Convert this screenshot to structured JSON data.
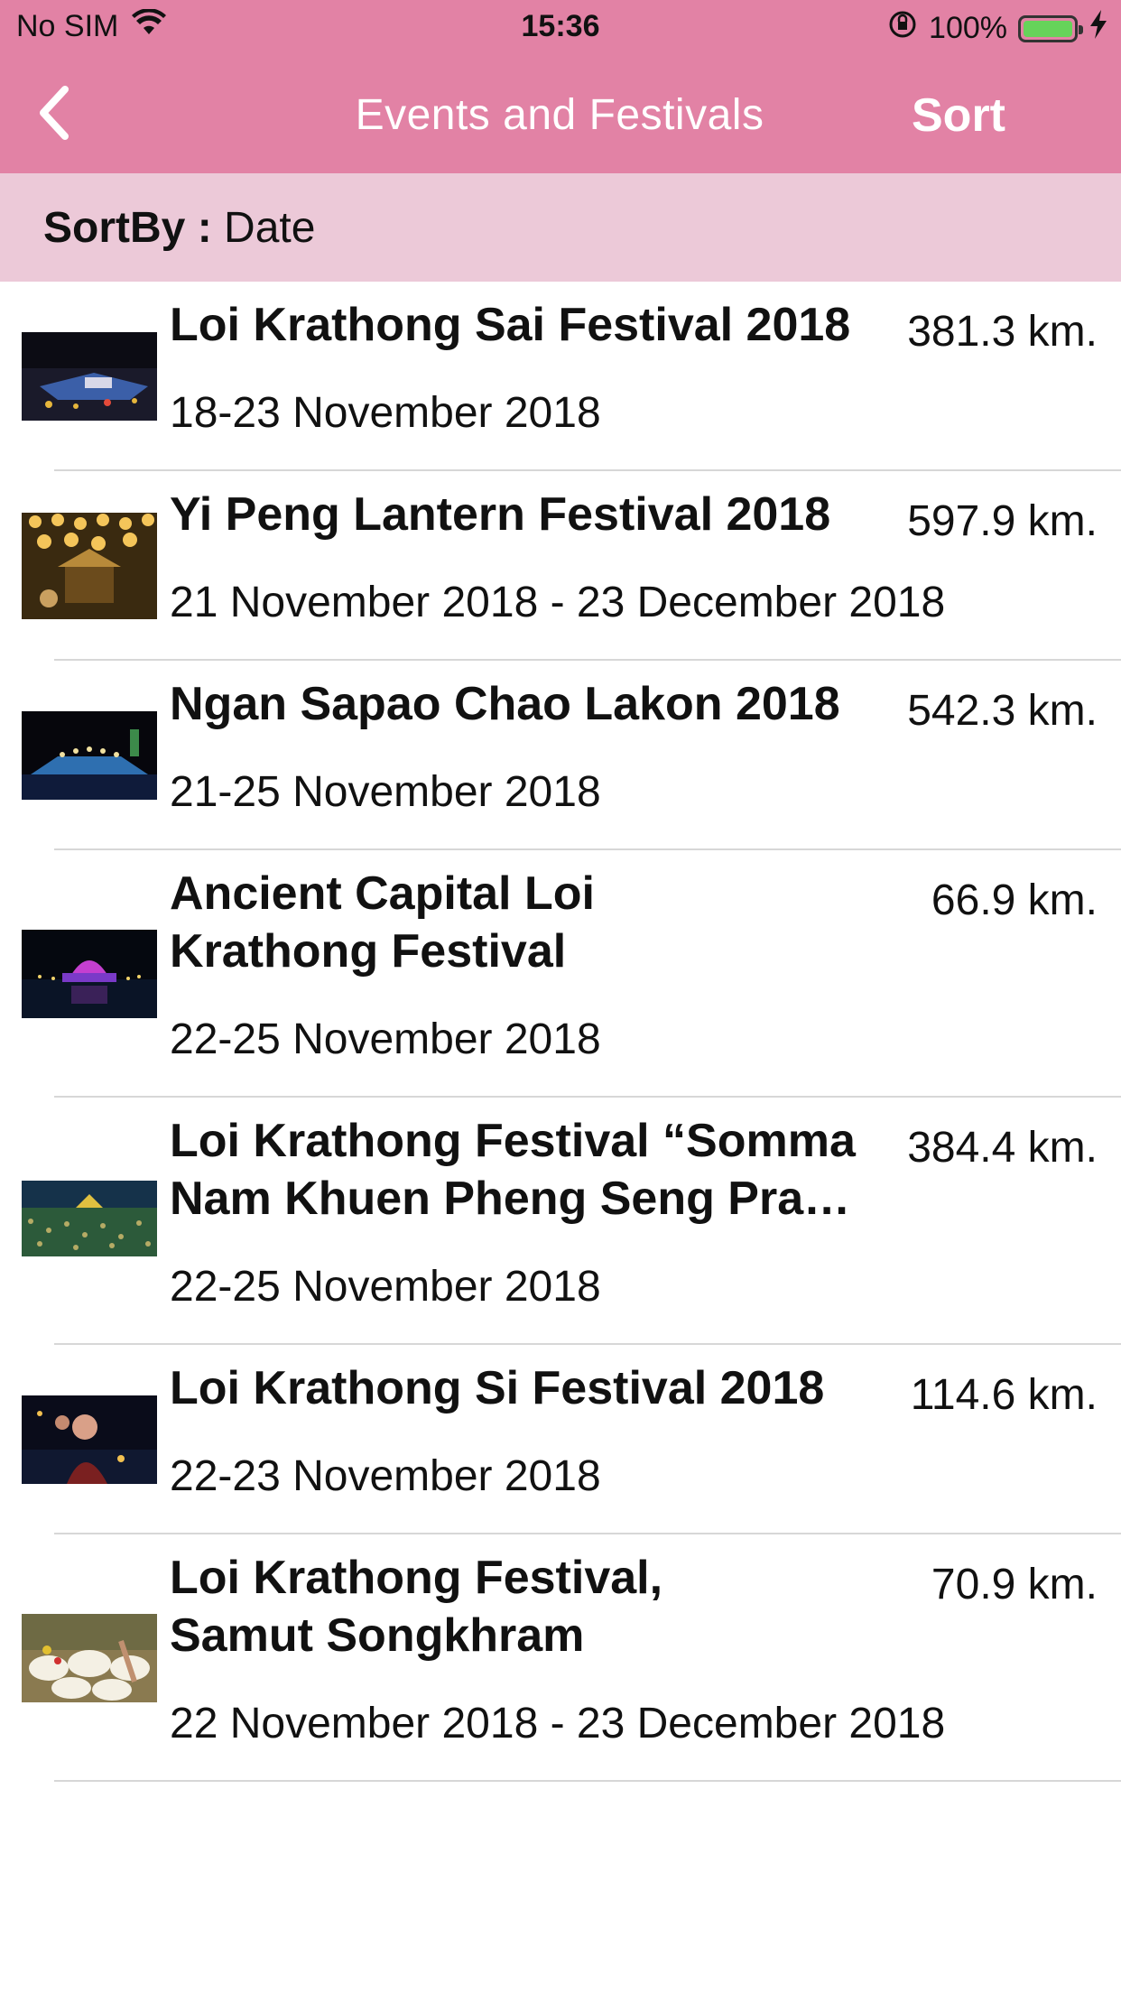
{
  "status_bar": {
    "carrier": "No SIM",
    "time": "15:36",
    "battery_percent": "100%",
    "battery_level": 1.0
  },
  "nav": {
    "title": "Events and Festivals",
    "sort_label": "Sort",
    "back_icon": "chevron-left-icon"
  },
  "sort_header": {
    "label": "SortBy :",
    "value": "Date"
  },
  "events": [
    {
      "title": "Loi Krathong Sai Festival 2018",
      "distance": "381.3 km.",
      "date": "18-23 November 2018"
    },
    {
      "title": "Yi Peng Lantern Festival 2018",
      "distance": "597.9 km.",
      "date": "21 November 2018 - 23 December 2018"
    },
    {
      "title": "Ngan Sapao Chao Lakon 2018",
      "distance": "542.3 km.",
      "date": "21-25 November 2018"
    },
    {
      "title": "Ancient Capital Loi Krathong Festival",
      "distance": "66.9 km.",
      "date": "22-25 November 2018"
    },
    {
      "title": "Loi Krathong Festival “Somma Nam Khuen Pheng Seng Pra…",
      "distance": "384.4 km.",
      "date": "22-25 November 2018"
    },
    {
      "title": "Loi Krathong Si Festival 2018",
      "distance": "114.6 km.",
      "date": "22-23 November 2018"
    },
    {
      "title": "Loi Krathong Festival, Samut Songkhram",
      "distance": "70.9 km.",
      "date": "22 November 2018 - 23 December 2018"
    }
  ],
  "colors": {
    "nav_bg": "#e282a5",
    "sort_bg": "#ecc9d8",
    "battery": "#66d35a"
  }
}
